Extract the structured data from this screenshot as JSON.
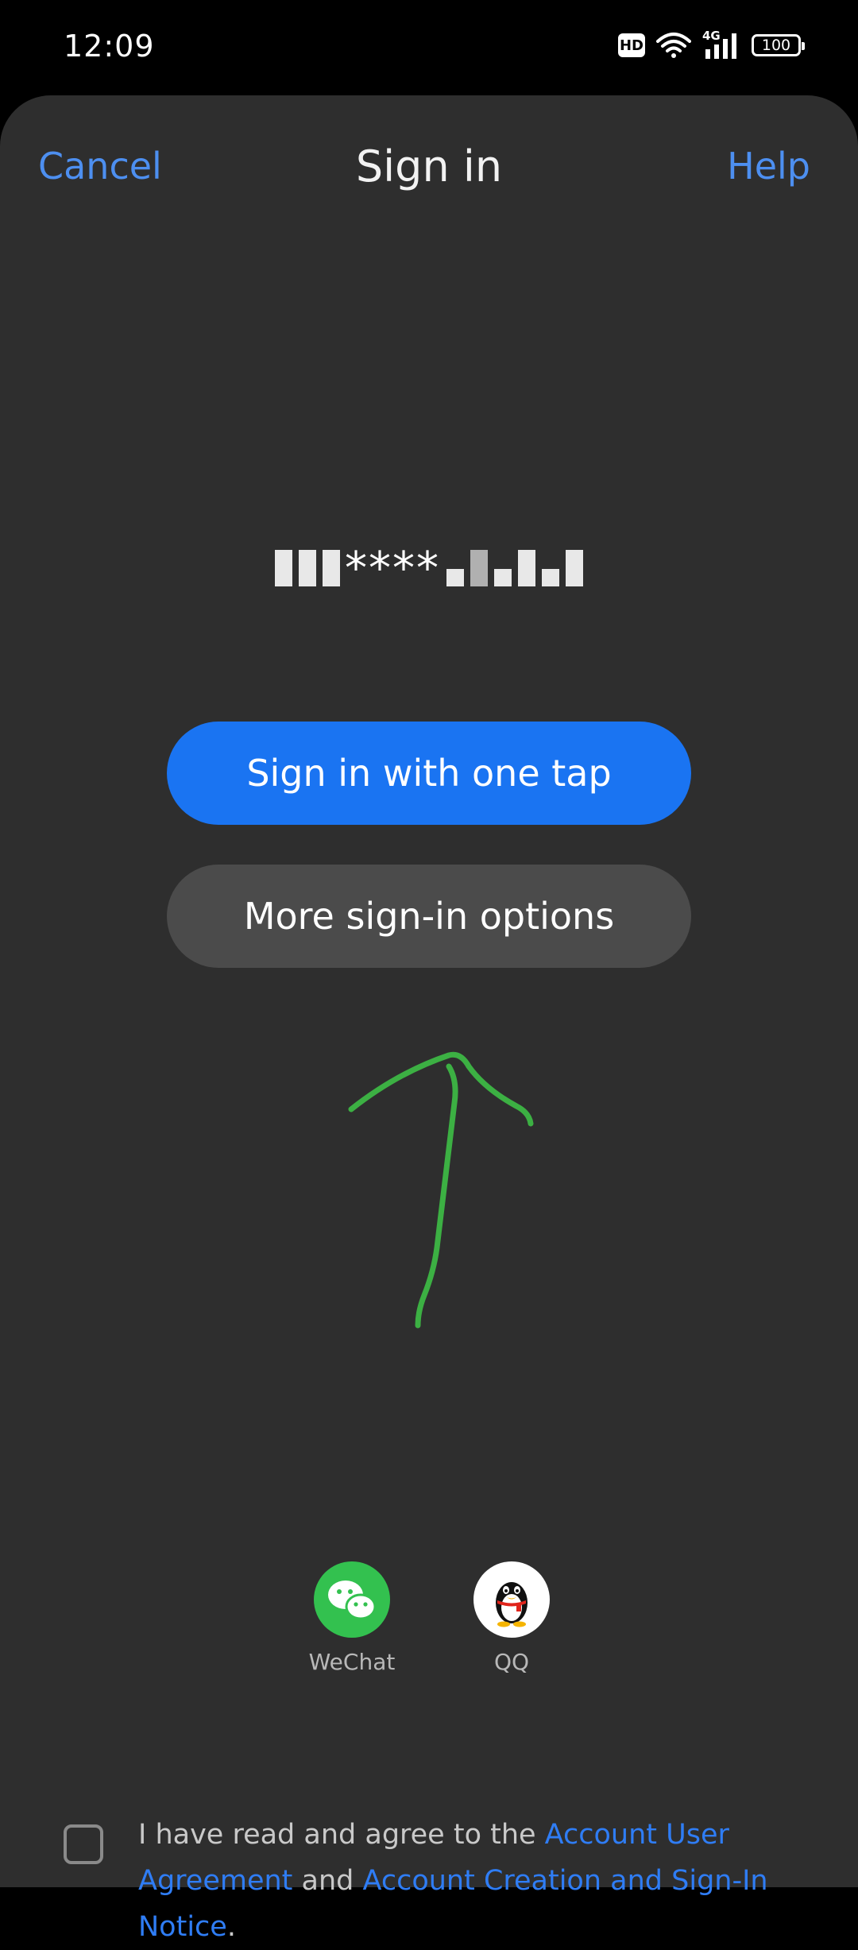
{
  "status_bar": {
    "time": "12:09",
    "hd": "HD",
    "network": "4G",
    "battery": "100"
  },
  "nav": {
    "cancel": "Cancel",
    "title": "Sign in",
    "help": "Help"
  },
  "account": {
    "masked_visible": "****"
  },
  "buttons": {
    "one_tap": "Sign in with one tap",
    "more_options": "More sign-in options"
  },
  "social": {
    "wechat": "WeChat",
    "qq": "QQ"
  },
  "agreement": {
    "prefix": "I have read and agree to the ",
    "link1": "Account User Agreement",
    "middle": " and ",
    "link2": "Account Creation and Sign-In Notice",
    "suffix": "."
  },
  "colors": {
    "accent": "#1a74f2",
    "link": "#4d8ff0",
    "sheet": "#2e2e2e",
    "annotation": "#3cb043"
  }
}
